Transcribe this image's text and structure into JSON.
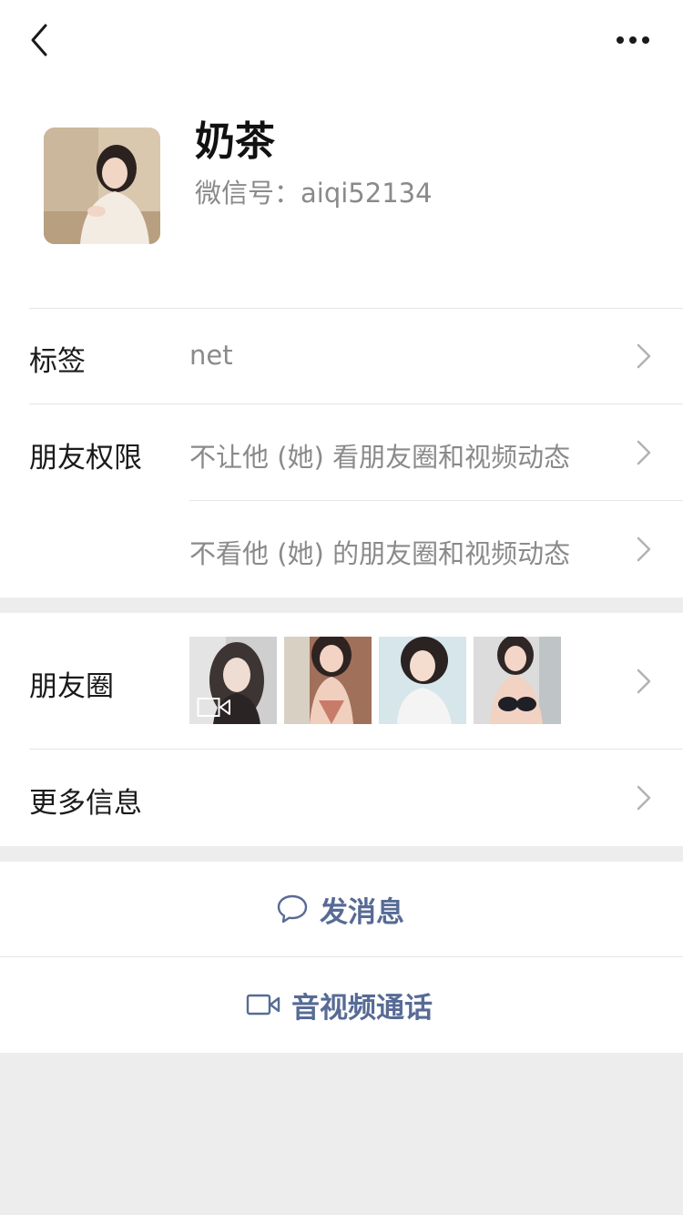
{
  "profile": {
    "nickname": "奶茶",
    "wechat_id": "微信号：aiqi52134"
  },
  "rows": {
    "tags": {
      "label": "标签",
      "value": "net"
    },
    "friend_permission": {
      "label": "朋友权限",
      "option_hide_mine": "不让他 (她) 看朋友圈和视频动态",
      "option_hide_theirs": "不看他 (她) 的朋友圈和视频动态"
    },
    "moments": {
      "label": "朋友圈"
    },
    "more_info": {
      "label": "更多信息"
    }
  },
  "actions": {
    "send_message": "发消息",
    "video_call": "音视频通话"
  },
  "colors": {
    "link_blue": "#576b95",
    "secondary_text": "#8a8a8a",
    "page_bg": "#ededed"
  },
  "icons": [
    "back-icon",
    "more-icon",
    "chevron-right-icon",
    "chat-bubble-icon",
    "video-camera-icon"
  ]
}
